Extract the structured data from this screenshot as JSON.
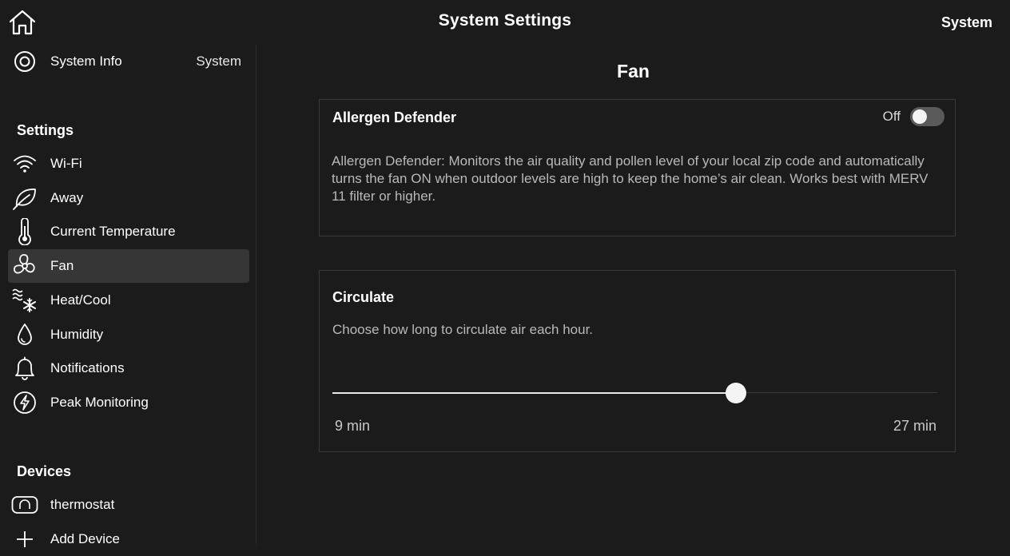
{
  "header": {
    "title": "System Settings",
    "system_name": "System"
  },
  "sidebar": {
    "system_info": {
      "label": "System Info",
      "value": "System",
      "icon": "target-icon"
    },
    "settings_heading": "Settings",
    "items": [
      {
        "label": "Wi-Fi",
        "icon": "wifi-icon",
        "active": false
      },
      {
        "label": "Away",
        "icon": "leaf-icon",
        "active": false
      },
      {
        "label": "Current Temperature",
        "icon": "thermometer-icon",
        "active": false
      },
      {
        "label": "Fan",
        "icon": "fan-icon",
        "active": true
      },
      {
        "label": "Heat/Cool",
        "icon": "heat-cool-icon",
        "active": false
      },
      {
        "label": "Humidity",
        "icon": "droplet-icon",
        "active": false
      },
      {
        "label": "Notifications",
        "icon": "bell-icon",
        "active": false
      },
      {
        "label": "Peak Monitoring",
        "icon": "lightning-icon",
        "active": false
      }
    ],
    "devices_heading": "Devices",
    "devices": [
      {
        "label": "thermostat",
        "icon": "thermostat-icon"
      },
      {
        "label": "Add Device",
        "icon": "plus-icon"
      }
    ]
  },
  "main": {
    "title": "Fan",
    "allergen": {
      "title": "Allergen Defender",
      "toggle_state": "Off",
      "enabled": false,
      "description": "Allergen Defender: Monitors the air quality and pollen level of your local zip code and automatically turns the fan ON when outdoor levels are high to keep the home’s air clean. Works best with MERV 11 filter or higher."
    },
    "circulate": {
      "title": "Circulate",
      "description": "Choose how long to circulate air each hour.",
      "min_label": "9 min",
      "max_label": "27 min",
      "slider_fraction": 0.667
    }
  },
  "colors": {
    "background": "#1b1b1b",
    "active_row": "#363636",
    "card_border": "#3a3a3a",
    "text": "#ffffff",
    "muted_text": "#b9b9b9"
  }
}
